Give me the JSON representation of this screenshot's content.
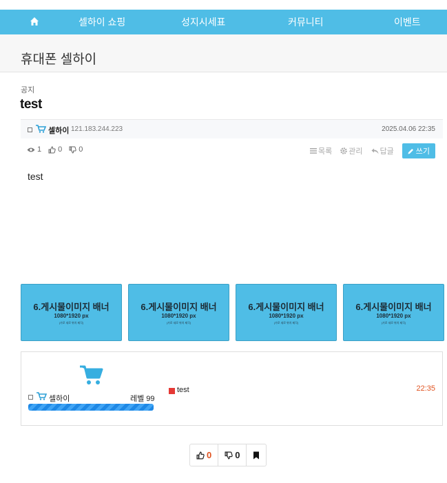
{
  "nav": {
    "home_icon": "home-icon",
    "items": [
      {
        "label": "셀하이 쇼핑"
      },
      {
        "label": "성지시세표"
      },
      {
        "label": "커뮤니티"
      },
      {
        "label": "이벤트"
      }
    ]
  },
  "board": {
    "title": "휴대폰 셀하이"
  },
  "post": {
    "category": "공지",
    "title": "test",
    "author": "셀하이",
    "ip": "121.183.244.223",
    "date": "2025.04.06 22:35",
    "views": "1",
    "likes": "0",
    "dislikes": "0",
    "content": "test"
  },
  "actions": {
    "list": "목록",
    "manage": "관리",
    "reply": "답글",
    "write": "쓰기"
  },
  "banners": [
    {
      "line1": "6.게시물이미지 배너",
      "line2": "1080*1920 px",
      "line3": "(가로 세로 위치 제각)"
    },
    {
      "line1": "6.게시물이미지 배너",
      "line2": "1080*1920 px",
      "line3": "(가로 세로 위치 제각)"
    },
    {
      "line1": "6.게시물이미지 배너",
      "line2": "1080*1920 px",
      "line3": "(가로 세로 위치 제각)"
    },
    {
      "line1": "6.게시물이미지 배너",
      "line2": "1080*1920 px",
      "line3": "(가로 세로 위치 제각)"
    }
  ],
  "profile": {
    "nick": "셀하이",
    "level": "레벨 99",
    "level_progress": 1.0,
    "latest_comment": "test",
    "latest_time": "22:35"
  },
  "vote": {
    "likes": "0",
    "dislikes": "0"
  },
  "colors": {
    "accent": "#4fbde6",
    "highlight": "#e0521f"
  }
}
